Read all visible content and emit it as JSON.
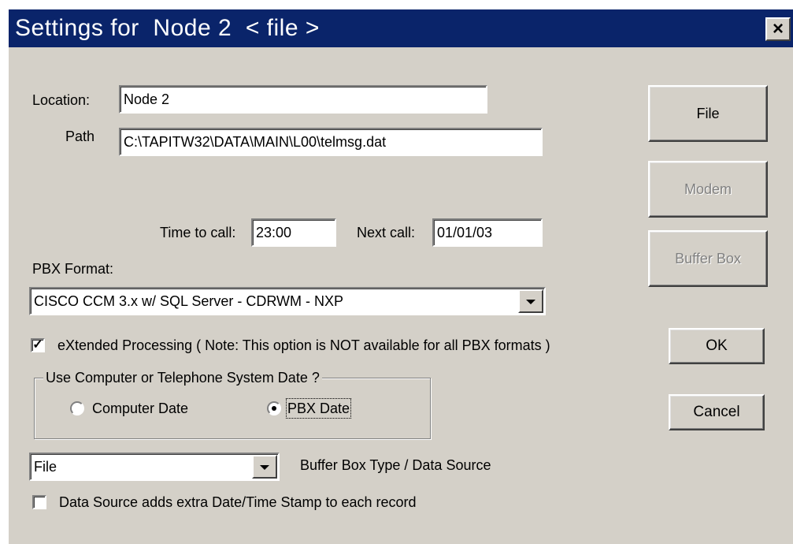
{
  "window": {
    "title": "Settings for  Node 2  < file >",
    "close_glyph": "×"
  },
  "fields": {
    "location_label": "Location:",
    "location_value": "Node 2",
    "path_label": "Path",
    "path_value": "C:\\TAPITW32\\DATA\\MAIN\\L00\\telmsg.dat",
    "time_to_call_label": "Time to call:",
    "time_to_call_value": "23:00",
    "next_call_label": "Next call:",
    "next_call_value": "01/01/03"
  },
  "pbx": {
    "label": "PBX Format:",
    "selected": "CISCO CCM 3.x  w/ SQL Server - CDRWM - NXP"
  },
  "extended": {
    "checked": true,
    "label": "eXtended Processing ( Note: This option is NOT available for all PBX formats )"
  },
  "date_group": {
    "legend": "Use Computer or Telephone System Date ?",
    "options": [
      {
        "label": "Computer Date",
        "selected": false
      },
      {
        "label": "PBX Date",
        "selected": true
      }
    ]
  },
  "source": {
    "selected": "File",
    "label": "Buffer Box Type / Data Source",
    "stamp_checked": false,
    "stamp_label": "Data Source adds extra Date/Time Stamp to each record"
  },
  "buttons": {
    "file": "File",
    "modem": "Modem",
    "buffer_box": "Buffer Box",
    "ok": "OK",
    "cancel": "Cancel"
  },
  "colors": {
    "titlebar": "#0a246a",
    "face": "#d4d0c8",
    "disabled_text": "#808080"
  }
}
